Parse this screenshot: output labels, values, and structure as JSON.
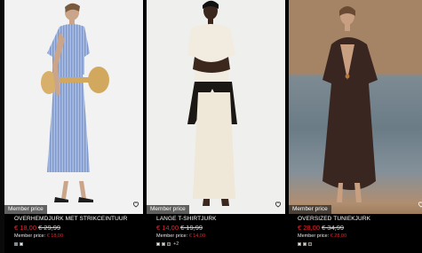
{
  "products": [
    {
      "badge": "Member price",
      "name": "OVERHEMDJURK MET STRIKCEINTUUR",
      "price": "€ 18,00",
      "old_price": "€ 29,99",
      "member_label": "Member price:",
      "member_price": "€ 18,00",
      "swatches": [
        "#6f89b8",
        "#e9e9e9"
      ],
      "more": ""
    },
    {
      "badge": "Member price",
      "name": "LANGE T-SHIRTJURK",
      "price": "€ 14,00",
      "old_price": "€ 19,99",
      "member_label": "Member price:",
      "member_price": "€ 14,00",
      "swatches": [
        "#f3ede2",
        "#d8d3c6",
        "#3a3a3a"
      ],
      "more": "+2"
    },
    {
      "badge": "Member price",
      "name": "OVERSIZED TUNIEKJURK",
      "price": "€ 28,00",
      "old_price": "€ 34,99",
      "member_label": "Member price:",
      "member_price": "€ 28,00",
      "swatches": [
        "#efe6d6",
        "#d9c9b0",
        "#3b2a22"
      ],
      "more": ""
    }
  ],
  "icons": {
    "wishlist": "heart-outline-icon"
  },
  "colors": {
    "sale_red": "#e3262d",
    "background": "#000000"
  }
}
